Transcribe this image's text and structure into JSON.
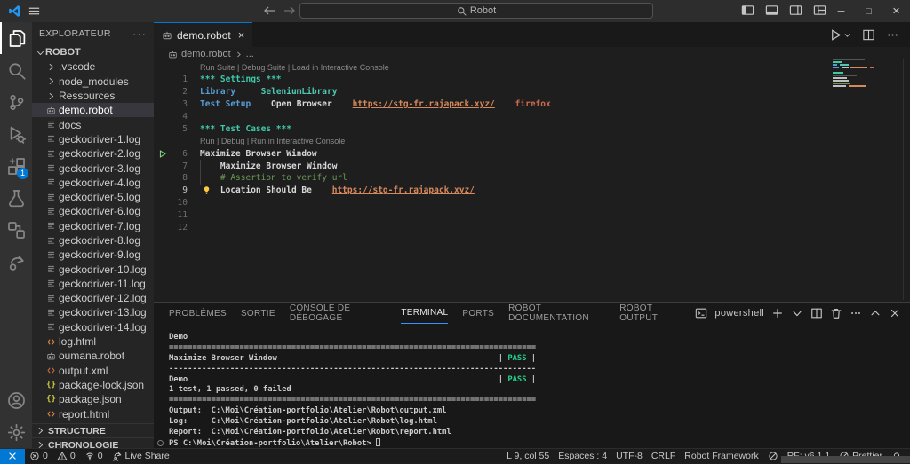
{
  "title_bar": {
    "search": "Robot",
    "layout_icons": [
      "layout-sidebar-left",
      "layout-panel",
      "layout-sidebar-right",
      "layout-customize"
    ],
    "window_controls": [
      "minimize",
      "maximize",
      "close"
    ]
  },
  "activity_bar": {
    "top": [
      {
        "name": "explorer",
        "active": true
      },
      {
        "name": "search"
      },
      {
        "name": "source-control"
      },
      {
        "name": "run-debug"
      },
      {
        "name": "extensions",
        "badge": "1"
      },
      {
        "name": "testing"
      },
      {
        "name": "references"
      },
      {
        "name": "live-share"
      }
    ],
    "bottom": [
      {
        "name": "account"
      },
      {
        "name": "settings"
      }
    ]
  },
  "sidebar": {
    "title": "EXPLORATEUR",
    "more_label": "···",
    "root": {
      "label": "ROBOT"
    },
    "items": [
      {
        "label": ".vscode",
        "type": "folder"
      },
      {
        "label": "node_modules",
        "type": "folder"
      },
      {
        "label": "Ressources",
        "type": "folder"
      },
      {
        "label": "demo.robot",
        "type": "robot",
        "selected": true
      },
      {
        "label": "docs",
        "type": "log"
      },
      {
        "label": "geckodriver-1.log",
        "type": "log"
      },
      {
        "label": "geckodriver-2.log",
        "type": "log"
      },
      {
        "label": "geckodriver-3.log",
        "type": "log"
      },
      {
        "label": "geckodriver-4.log",
        "type": "log"
      },
      {
        "label": "geckodriver-5.log",
        "type": "log"
      },
      {
        "label": "geckodriver-6.log",
        "type": "log"
      },
      {
        "label": "geckodriver-7.log",
        "type": "log"
      },
      {
        "label": "geckodriver-8.log",
        "type": "log"
      },
      {
        "label": "geckodriver-9.log",
        "type": "log"
      },
      {
        "label": "geckodriver-10.log",
        "type": "log"
      },
      {
        "label": "geckodriver-11.log",
        "type": "log"
      },
      {
        "label": "geckodriver-12.log",
        "type": "log"
      },
      {
        "label": "geckodriver-13.log",
        "type": "log"
      },
      {
        "label": "geckodriver-14.log",
        "type": "log"
      },
      {
        "label": "log.html",
        "type": "html"
      },
      {
        "label": "oumana.robot",
        "type": "robot"
      },
      {
        "label": "output.xml",
        "type": "xml"
      },
      {
        "label": "package-lock.json",
        "type": "json"
      },
      {
        "label": "package.json",
        "type": "json"
      },
      {
        "label": "report.html",
        "type": "html"
      }
    ],
    "sections": [
      {
        "label": "STRUCTURE"
      },
      {
        "label": "CHRONOLOGIE"
      }
    ]
  },
  "editor": {
    "tab": {
      "label": "demo.robot"
    },
    "breadcrumb": {
      "file": "demo.robot",
      "more": "..."
    },
    "code": [
      {
        "type": "codelens",
        "text": "Run Suite | Debug Suite | Load in Interactive Console"
      },
      {
        "type": "line",
        "num": "1",
        "segs": [
          {
            "t": "*** Settings ***",
            "c": "section"
          }
        ]
      },
      {
        "type": "line",
        "num": "2",
        "segs": [
          {
            "t": "Library",
            "c": "kw"
          },
          {
            "t": "     "
          },
          {
            "t": "SeleniumLibrary",
            "c": "type"
          }
        ]
      },
      {
        "type": "line",
        "num": "3",
        "segs": [
          {
            "t": "Test Setup",
            "c": "kw"
          },
          {
            "t": "    "
          },
          {
            "t": "Open Browser",
            "c": "plain"
          },
          {
            "t": "    "
          },
          {
            "t": "https://stg-fr.rajapack.xyz/",
            "c": "url"
          },
          {
            "t": "    "
          },
          {
            "t": "firefox",
            "c": "str"
          }
        ]
      },
      {
        "type": "line",
        "num": "4",
        "segs": []
      },
      {
        "type": "line",
        "num": "5",
        "segs": [
          {
            "t": "*** Test Cases ***",
            "c": "section"
          }
        ]
      },
      {
        "type": "codelens",
        "text": "Run | Debug | Run in Interactive Console"
      },
      {
        "type": "line",
        "num": "6",
        "segs": [
          {
            "t": "Maximize Browser Window",
            "c": "plain"
          }
        ],
        "gutter": "run"
      },
      {
        "type": "line",
        "num": "7",
        "segs": [
          {
            "t": "    Maximize Browser Window",
            "c": "plain"
          }
        ],
        "guide": true
      },
      {
        "type": "line",
        "num": "8",
        "segs": [
          {
            "t": "    # Assertion to verify url",
            "c": "comment"
          }
        ],
        "guide": true
      },
      {
        "type": "line",
        "num": "9",
        "segs": [
          {
            "t": "    Location Should Be",
            "c": "plain"
          },
          {
            "t": "    "
          },
          {
            "t": "https://stg-fr.rajapack.xyz/",
            "c": "url"
          }
        ],
        "bulb": true,
        "active": true
      },
      {
        "type": "line",
        "num": "10",
        "segs": []
      },
      {
        "type": "line",
        "num": "11",
        "segs": []
      },
      {
        "type": "line",
        "num": "12",
        "segs": []
      }
    ]
  },
  "panel": {
    "tabs": [
      {
        "label": "PROBLÈMES"
      },
      {
        "label": "SORTIE"
      },
      {
        "label": "CONSOLE DE DÉBOGAGE"
      },
      {
        "label": "TERMINAL",
        "active": true
      },
      {
        "label": "PORTS"
      },
      {
        "label": "ROBOT DOCUMENTATION"
      },
      {
        "label": "ROBOT OUTPUT"
      }
    ],
    "shell": "powershell",
    "header_icons": [
      "plus",
      "chevron-down",
      "split",
      "trash",
      "ellipsis",
      "chevron-up",
      "close"
    ],
    "terminal": [
      {
        "segs": [
          {
            "t": "Demo"
          }
        ]
      },
      {
        "segs": [
          {
            "t": "=============================================================================="
          }
        ]
      },
      {
        "segs": [
          {
            "t": "Maximize Browser Window                                               | "
          },
          {
            "t": "PASS",
            "c": "pass"
          },
          {
            "t": " |"
          }
        ]
      },
      {
        "segs": [
          {
            "t": "------------------------------------------------------------------------------"
          }
        ]
      },
      {
        "segs": [
          {
            "t": "Demo                                                                  | "
          },
          {
            "t": "PASS",
            "c": "pass"
          },
          {
            "t": " |"
          }
        ]
      },
      {
        "segs": [
          {
            "t": "1 test, 1 passed, 0 failed"
          }
        ]
      },
      {
        "segs": [
          {
            "t": "=============================================================================="
          }
        ]
      },
      {
        "segs": [
          {
            "t": "Output:  C:\\Moi\\Création-portfolio\\Atelier\\Robot\\output.xml"
          }
        ]
      },
      {
        "segs": [
          {
            "t": "Log:     C:\\Moi\\Création-portfolio\\Atelier\\Robot\\log.html"
          }
        ]
      },
      {
        "segs": [
          {
            "t": "Report:  C:\\Moi\\Création-portfolio\\Atelier\\Robot\\report.html"
          }
        ]
      },
      {
        "segs": [
          {
            "t": "PS C:\\Moi\\Création-portfolio\\Atelier\\Robot> "
          }
        ],
        "cursor": true,
        "decoration": true
      }
    ]
  },
  "status_bar": {
    "left": [
      {
        "name": "remote-indicator",
        "icon": "remote",
        "text": ""
      },
      {
        "name": "errors",
        "icon": "error",
        "text": "0"
      },
      {
        "name": "warnings",
        "icon": "warning",
        "text": "0"
      },
      {
        "name": "ports-forwarded",
        "icon": "broadcast",
        "text": "0"
      },
      {
        "name": "live-share",
        "icon": "live-share-small",
        "text": "Live Share"
      }
    ],
    "right": [
      {
        "name": "cursor-position",
        "text": "L 9, col 55"
      },
      {
        "name": "indentation",
        "text": "Espaces : 4"
      },
      {
        "name": "encoding",
        "text": "UTF-8"
      },
      {
        "name": "eol",
        "text": "CRLF"
      },
      {
        "name": "language-mode",
        "text": "Robot Framework"
      },
      {
        "name": "feedback",
        "icon": "slash-circle",
        "text": ""
      },
      {
        "name": "rf-version",
        "text": "RF: v6.1.1"
      },
      {
        "name": "prettier",
        "icon": "slash-circle",
        "text": "Prettier"
      },
      {
        "name": "notifications",
        "icon": "bell",
        "text": ""
      }
    ]
  },
  "colors": {
    "accent_blue": "#0078d4",
    "pass_green": "#23d18b",
    "run_green": "#89d185",
    "bulb_yellow": "#ffcb3d"
  }
}
